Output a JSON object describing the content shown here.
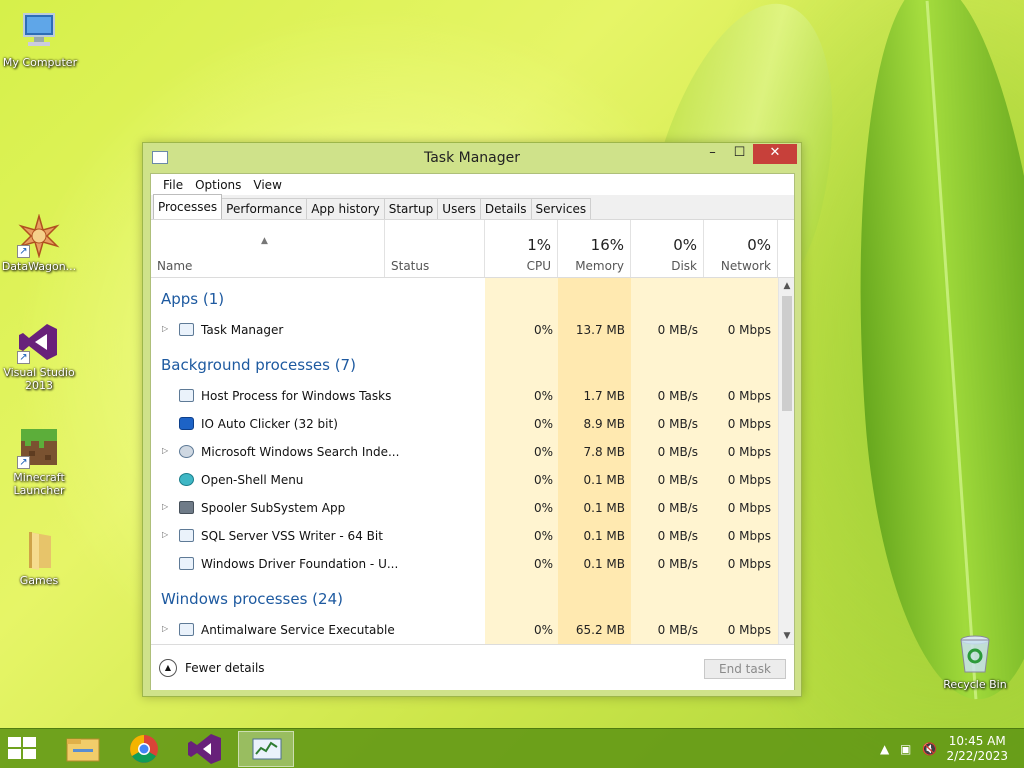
{
  "desktop": {
    "icons": [
      {
        "label": "My Computer",
        "icon": "computer-icon"
      },
      {
        "label": "DataWagon...",
        "icon": "datawagon-icon"
      },
      {
        "label": "Visual Studio 2013",
        "icon": "visual-studio-icon"
      },
      {
        "label": "Minecraft Launcher",
        "icon": "minecraft-icon"
      },
      {
        "label": "Games",
        "icon": "folder-icon"
      },
      {
        "label": "Recycle Bin",
        "icon": "recycle-bin-icon"
      }
    ]
  },
  "window": {
    "title": "Task Manager",
    "menu": [
      "File",
      "Options",
      "View"
    ],
    "tabs": [
      "Processes",
      "Performance",
      "App history",
      "Startup",
      "Users",
      "Details",
      "Services"
    ],
    "active_tab": "Processes",
    "columns": {
      "name": "Name",
      "status": "Status",
      "cpu": {
        "pct": "1%",
        "label": "CPU"
      },
      "memory": {
        "pct": "16%",
        "label": "Memory"
      },
      "disk": {
        "pct": "0%",
        "label": "Disk"
      },
      "network": {
        "pct": "0%",
        "label": "Network"
      }
    },
    "groups": {
      "apps": "Apps (1)",
      "background": "Background processes (7)",
      "windows": "Windows processes (24)"
    },
    "rows": [
      {
        "name": "Task Manager",
        "cpu": "0%",
        "mem": "13.7 MB",
        "disk": "0 MB/s",
        "net": "0 Mbps"
      },
      {
        "name": "Host Process for Windows Tasks",
        "cpu": "0%",
        "mem": "1.7 MB",
        "disk": "0 MB/s",
        "net": "0 Mbps"
      },
      {
        "name": "IO Auto Clicker (32 bit)",
        "cpu": "0%",
        "mem": "8.9 MB",
        "disk": "0 MB/s",
        "net": "0 Mbps"
      },
      {
        "name": "Microsoft Windows Search Inde...",
        "cpu": "0%",
        "mem": "7.8 MB",
        "disk": "0 MB/s",
        "net": "0 Mbps"
      },
      {
        "name": "Open-Shell Menu",
        "cpu": "0%",
        "mem": "0.1 MB",
        "disk": "0 MB/s",
        "net": "0 Mbps"
      },
      {
        "name": "Spooler SubSystem App",
        "cpu": "0%",
        "mem": "0.1 MB",
        "disk": "0 MB/s",
        "net": "0 Mbps"
      },
      {
        "name": "SQL Server VSS Writer - 64 Bit",
        "cpu": "0%",
        "mem": "0.1 MB",
        "disk": "0 MB/s",
        "net": "0 Mbps"
      },
      {
        "name": "Windows Driver Foundation - U...",
        "cpu": "0%",
        "mem": "0.1 MB",
        "disk": "0 MB/s",
        "net": "0 Mbps"
      },
      {
        "name": "Antimalware Service Executable",
        "cpu": "0%",
        "mem": "65.2 MB",
        "disk": "0 MB/s",
        "net": "0 Mbps"
      }
    ],
    "fewer_details": "Fewer details",
    "end_task": "End task"
  },
  "taskbar": {
    "time": "10:45 AM",
    "date": "2/22/2023"
  },
  "colors": {
    "close_button": "#c7403a",
    "group_text": "#1e5aa0",
    "cpu_column": "#fff4d0",
    "memory_column": "#ffe9b0",
    "taskbar": "#6c9a18"
  }
}
